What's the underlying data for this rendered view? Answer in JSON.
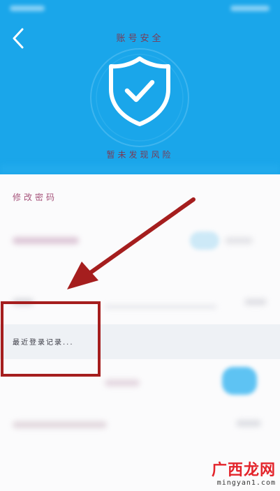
{
  "header": {
    "title": "账号安全",
    "status": "暂未发现风险",
    "icons": {
      "back": "chevron-left-icon",
      "shield": "shield-check-icon"
    }
  },
  "list": {
    "change_password": "修改密码",
    "recent_login": "最近登录记录..."
  },
  "annotation": {
    "color": "#a51e1e"
  },
  "watermark": {
    "logo": "广西龙网",
    "url": "mingyan1.com"
  },
  "colors": {
    "header_bg": "#1aa6ea",
    "accent_text": "#7a3b55",
    "toggle_blue": "#5ec3f3"
  }
}
